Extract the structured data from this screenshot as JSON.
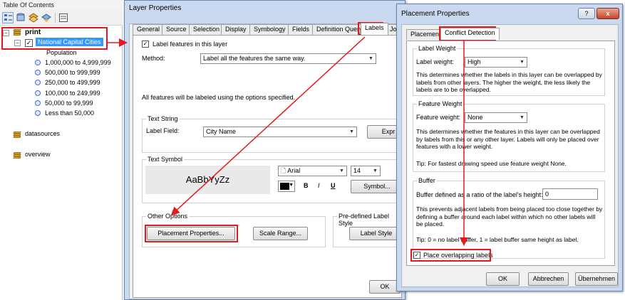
{
  "toc": {
    "title": "Table Of Contents",
    "toolbar_icons": [
      "list-by-drawing-order-icon",
      "list-by-source-icon",
      "list-by-visibility-icon",
      "list-by-selection-icon",
      "options-icon"
    ],
    "layers": [
      {
        "name": "print",
        "expanded": true
      },
      {
        "name": "datasources"
      },
      {
        "name": "overview"
      }
    ],
    "sublayer": {
      "name": "National Capital Cities",
      "checked": true
    },
    "legend_heading": "Population",
    "legend_items": [
      "1,000,000 to 4,999,999",
      "500,000 to 999,999",
      "250,000 to 499,999",
      "100,000 to 249,999",
      "50,000 to 99,999",
      "Less than 50,000"
    ]
  },
  "layer_props": {
    "title": "Layer Properties",
    "tabs": [
      "General",
      "Source",
      "Selection",
      "Display",
      "Symbology",
      "Fields",
      "Definition Query",
      "Labels",
      "Joins"
    ],
    "selected_tab": "Labels",
    "label_features_checkbox": "Label features in this layer",
    "method_label": "Method:",
    "method_value": "Label all the features the same way.",
    "info_text": "All features will be labeled using the options specified.",
    "text_string_group": "Text String",
    "label_field_label": "Label Field:",
    "label_field_value": "City Name",
    "expression_button": "Expr",
    "text_symbol_group": "Text Symbol",
    "sample_text": "AaBbYyZz",
    "font_value": "Arial",
    "size_value": "14",
    "bold": "B",
    "italic": "I",
    "underline": "U",
    "symbol_button": "Symbol...",
    "other_options_group": "Other Options",
    "placement_button": "Placement Properties...",
    "scale_range_button": "Scale Range...",
    "predefined_group": "Pre-defined Label Style",
    "label_styles_button": "Label Style",
    "ok_button": "OK"
  },
  "placement_props": {
    "title": "Placement Properties",
    "help_button": "?",
    "close_button": "x",
    "tabs": [
      "Placement",
      "Conflict Detection"
    ],
    "selected_tab": "Conflict Detection",
    "label_weight_group": "Label Weight",
    "label_weight_label": "Label weight:",
    "label_weight_value": "High",
    "label_weight_desc": "This determines whether the labels in this layer can be overlapped by labels from other layers.  The higher the weight, the less likely the labels are to be overlapped.",
    "feature_weight_group": "Feature Weight",
    "feature_weight_label": "Feature weight:",
    "feature_weight_value": "None",
    "feature_weight_desc": "This determines whether the features in this layer can be overlapped by labels from this or any other layer.  Labels will only be placed over features with a lower weight.",
    "feature_weight_tip": "Tip:  For fastest drawing speed use feature weight None.",
    "buffer_group": "Buffer",
    "buffer_label": "Buffer defined as a ratio of the label's height:",
    "buffer_value": "0",
    "buffer_desc": "This prevents adjacent labels from being placed too close together by defining a buffer around each label within which no other labels will be placed.",
    "buffer_tip": "Tip:  0 = no label buffer, 1 = label buffer same height as label.",
    "overlap_checkbox": "Place overlapping labels",
    "ok_button": "OK",
    "cancel_button": "Abbrechen",
    "apply_button": "Übernehmen"
  },
  "colors": {
    "highlight": "#e8171f",
    "selection_blue": "#3399ff",
    "window_frame": "#c9daf0"
  }
}
